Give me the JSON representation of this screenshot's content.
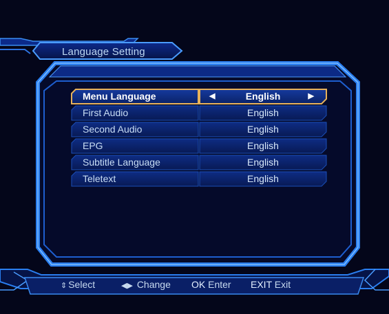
{
  "title": "Language Setting",
  "rows": [
    {
      "label": "Menu Language",
      "value": "English",
      "selected": true
    },
    {
      "label": "First Audio",
      "value": "English",
      "selected": false
    },
    {
      "label": "Second Audio",
      "value": "English",
      "selected": false
    },
    {
      "label": "EPG",
      "value": "English",
      "selected": false
    },
    {
      "label": "Subtitle Language",
      "value": "English",
      "selected": false
    },
    {
      "label": "Teletext",
      "value": "English",
      "selected": false
    }
  ],
  "legend": {
    "select_symbol": "⇕",
    "select_label": "Select",
    "change_symbol": "◀▶",
    "change_label": "Change",
    "ok_key": "OK",
    "ok_label": "Enter",
    "exit_key": "EXIT",
    "exit_label": "Exit"
  },
  "colors": {
    "background": "#04061a",
    "frame_blue": "#1f6fe0",
    "frame_light": "#5fb0ff",
    "row_fill": "#0a1e63",
    "selected_border": "#e8b25a"
  },
  "selected_arrows": {
    "left": "◀",
    "right": "▶"
  }
}
